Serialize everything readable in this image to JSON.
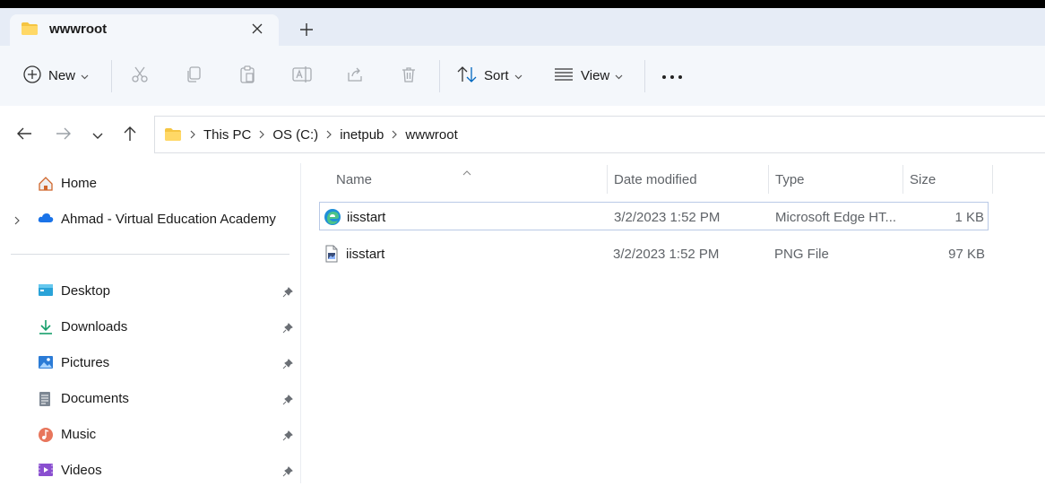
{
  "window": {
    "tab_title": "wwwroot"
  },
  "toolbar": {
    "new_label": "New",
    "sort_label": "Sort",
    "view_label": "View"
  },
  "address": {
    "crumbs": [
      "This PC",
      "OS (C:)",
      "inetpub",
      "wwwroot"
    ]
  },
  "sidebar": {
    "home": "Home",
    "account": "Ahmad - Virtual Education Academy",
    "pinned": [
      {
        "label": "Desktop",
        "icon": "desktop-icon"
      },
      {
        "label": "Downloads",
        "icon": "downloads-icon"
      },
      {
        "label": "Pictures",
        "icon": "pictures-icon"
      },
      {
        "label": "Documents",
        "icon": "documents-icon"
      },
      {
        "label": "Music",
        "icon": "music-icon"
      },
      {
        "label": "Videos",
        "icon": "videos-icon"
      }
    ]
  },
  "files": {
    "columns": [
      "Name",
      "Date modified",
      "Type",
      "Size"
    ],
    "rows": [
      {
        "name": "iisstart",
        "date": "3/2/2023 1:52 PM",
        "type": "Microsoft Edge HT...",
        "size": "1 KB",
        "icon": "edge-html-icon",
        "selected": true
      },
      {
        "name": "iisstart",
        "date": "3/2/2023 1:52 PM",
        "type": "PNG File",
        "size": "97 KB",
        "icon": "png-file-icon",
        "selected": false
      }
    ]
  },
  "colors": {
    "accent": "#0067c0",
    "tabbar": "#e6ecf6",
    "toolbar": "#f4f7fb",
    "folder": "#f5c542"
  }
}
